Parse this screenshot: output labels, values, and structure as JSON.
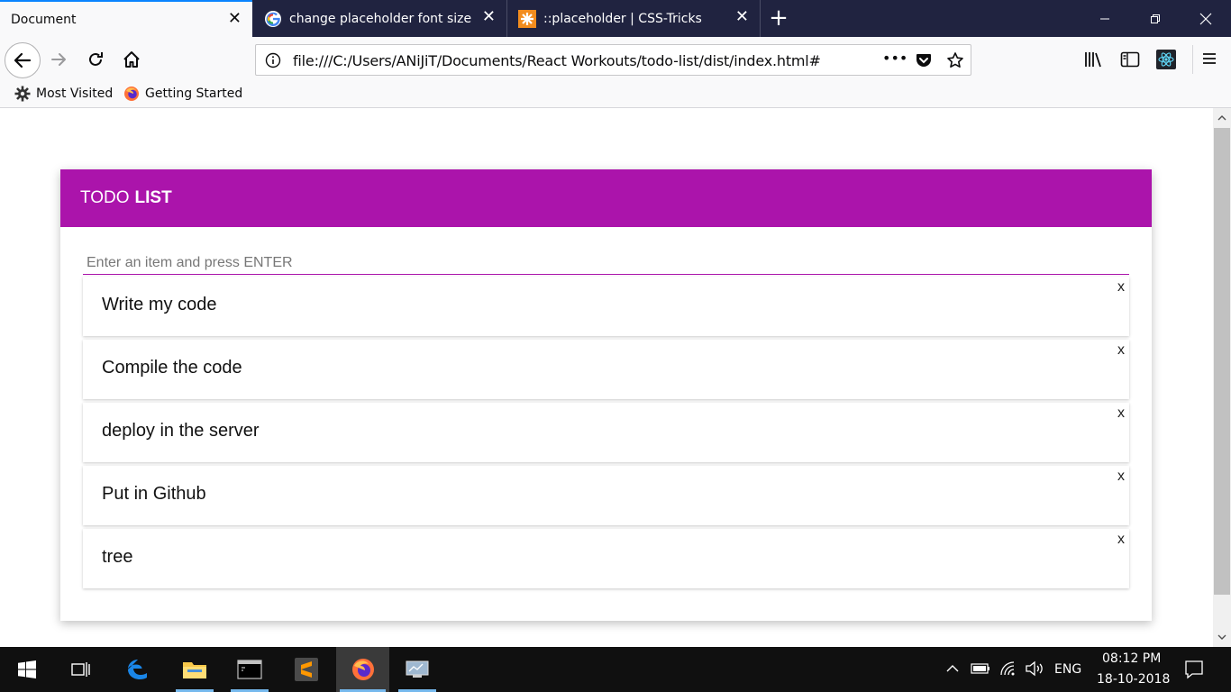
{
  "browser": {
    "tabs": [
      {
        "title": "Document",
        "active": true
      },
      {
        "title": "change placeholder font size - (",
        "active": false,
        "icon": "google-icon"
      },
      {
        "title": "::placeholder | CSS-Tricks",
        "active": false,
        "icon": "css-tricks-icon"
      }
    ],
    "close_glyph": "✕",
    "new_tab_glyph": "+",
    "url": "file:///C:/Users/ANiJiT/Documents/React Workouts/todo-list/dist/index.html#",
    "page_actions_glyph": "•••",
    "bookmarks": [
      "Most Visited",
      "Getting Started"
    ]
  },
  "app": {
    "header_normal": "TODO",
    "header_bold": "LIST",
    "input_placeholder": "Enter an item and press ENTER",
    "delete_label": "x",
    "items": [
      "Write my code",
      "Compile the code",
      "deploy in the server",
      "Put in Github",
      "tree"
    ],
    "accent_color": "#ab14ab"
  },
  "taskbar": {
    "language": "ENG",
    "time": "08:12 PM",
    "date": "18-10-2018"
  }
}
